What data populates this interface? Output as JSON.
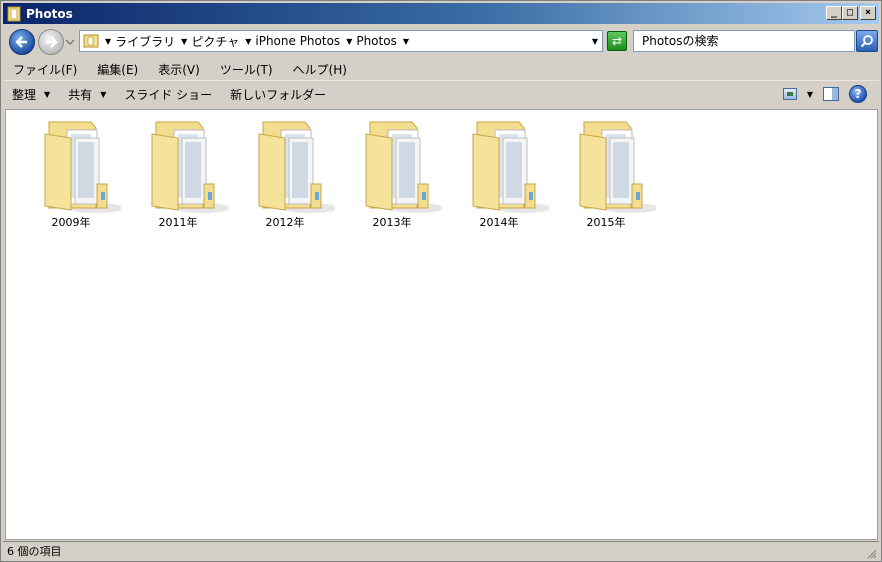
{
  "window": {
    "title": "Photos",
    "minimize": "_",
    "maximize": "□",
    "close": "×"
  },
  "address": {
    "crumbs": [
      "ライブラリ",
      "ピクチャ",
      "iPhone Photos",
      "Photos"
    ]
  },
  "search": {
    "placeholder": "Photosの検索"
  },
  "menu": {
    "items": [
      "ファイル(F)",
      "編集(E)",
      "表示(V)",
      "ツール(T)",
      "ヘルプ(H)"
    ]
  },
  "commands": {
    "organize": "整理",
    "share": "共有",
    "slideshow": "スライド ショー",
    "new_folder": "新しいフォルダー",
    "help": "?"
  },
  "folders": [
    {
      "name": "2009年"
    },
    {
      "name": "2011年"
    },
    {
      "name": "2012年"
    },
    {
      "name": "2013年"
    },
    {
      "name": "2014年"
    },
    {
      "name": "2015年"
    }
  ],
  "status": {
    "text": "6 個の項目"
  },
  "colors": {
    "titlebar_start": "#0a246a",
    "titlebar_end": "#a6caf0",
    "chrome": "#d4d0c8",
    "folder": "#f2dc8a"
  }
}
